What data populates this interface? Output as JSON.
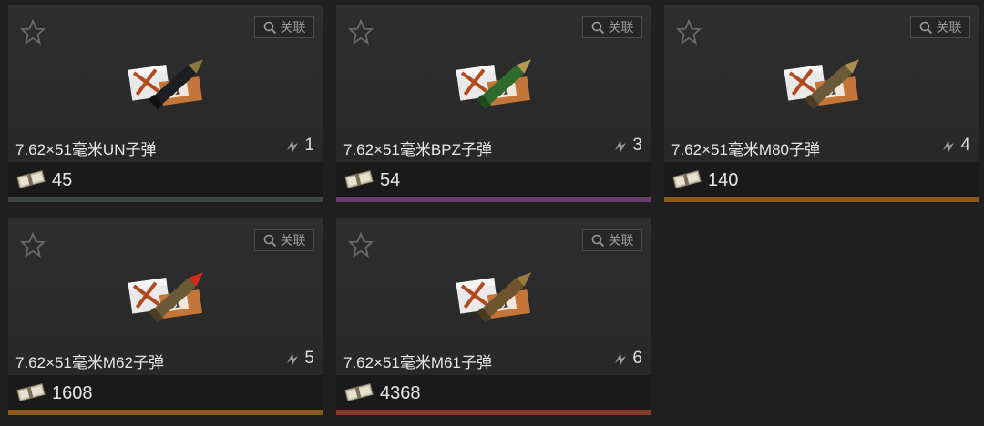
{
  "cards": [
    {
      "name": "7.62×51毫米UN子弹",
      "count": "1",
      "price": "45",
      "relate_label": "关联",
      "rarity_color": "#3f4547",
      "casing": "#1b1f24",
      "tip": "#8a7a40"
    },
    {
      "name": "7.62×51毫米BPZ子弹",
      "count": "3",
      "price": "54",
      "relate_label": "关联",
      "rarity_color": "#6a3b6f",
      "casing": "#2f6b2c",
      "tip": "#b09a55"
    },
    {
      "name": "7.62×51毫米M80子弹",
      "count": "4",
      "price": "140",
      "relate_label": "关联",
      "rarity_color": "#8c5a18",
      "casing": "#6a5a3a",
      "tip": "#a8914e"
    },
    {
      "name": "7.62×51毫米M62子弹",
      "count": "5",
      "price": "1608",
      "relate_label": "关联",
      "rarity_color": "#8c5a18",
      "casing": "#6b5a36",
      "tip": "#d12a1a"
    },
    {
      "name": "7.62×51毫米M61子弹",
      "count": "6",
      "price": "4368",
      "relate_label": "关联",
      "rarity_color": "#8a3a2a",
      "casing": "#6e5530",
      "tip": "#9b7a3c"
    }
  ],
  "icons": {
    "favorite": "star-icon",
    "relate": "search-icon",
    "count": "stack-icon",
    "price": "money-icon"
  }
}
